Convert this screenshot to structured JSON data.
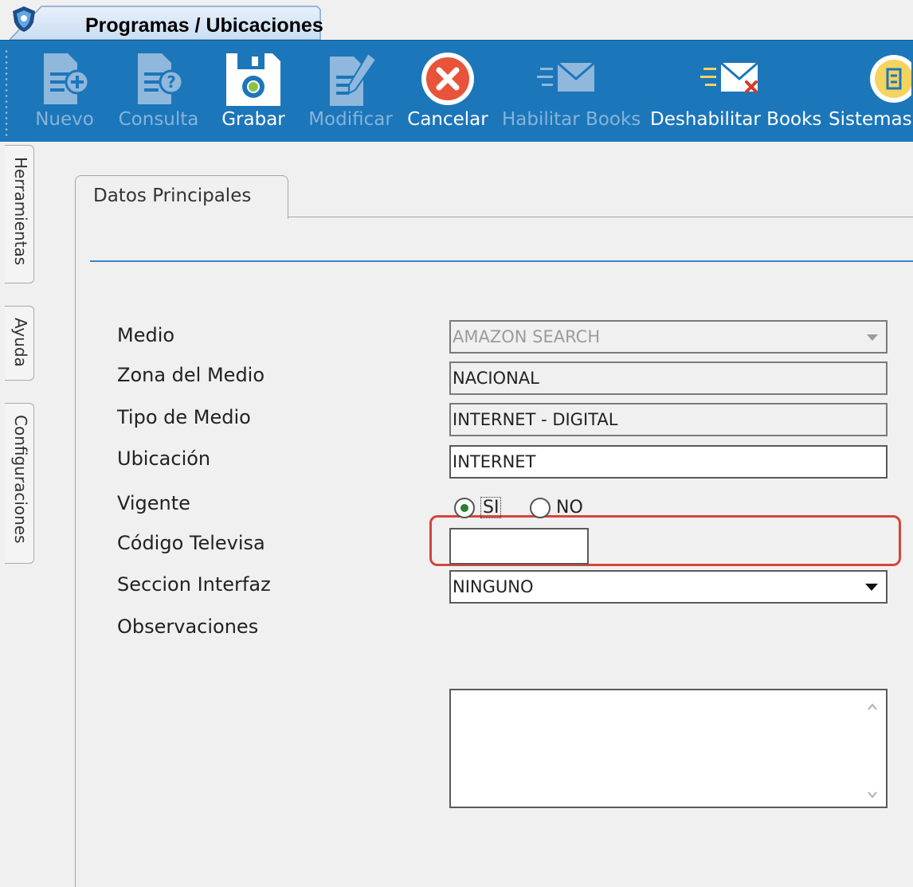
{
  "window": {
    "tab_title": "Programas / Ubicaciones",
    "icon": "shield-logo-icon"
  },
  "toolbar": {
    "buttons": [
      {
        "label": "Nuevo",
        "icon": "new-document-icon",
        "enabled": false
      },
      {
        "label": "Consulta",
        "icon": "query-document-icon",
        "enabled": false
      },
      {
        "label": "Grabar",
        "icon": "save-disk-icon",
        "enabled": true
      },
      {
        "label": "Modificar",
        "icon": "edit-document-icon",
        "enabled": false
      },
      {
        "label": "Cancelar",
        "icon": "cancel-icon",
        "enabled": true
      },
      {
        "label": "Habilitar Books",
        "icon": "mail-send-icon",
        "enabled": false
      },
      {
        "label": "Deshabilitar Books",
        "icon": "mail-disable-icon",
        "enabled": true
      },
      {
        "label": "Sistemas I",
        "icon": "systems-icon",
        "enabled": true
      }
    ]
  },
  "sidetabs": [
    "Herramientas",
    "Ayuda",
    "Configuraciones"
  ],
  "panel": {
    "tab_label": "Datos Principales",
    "fields": {
      "medio": {
        "label": "Medio",
        "value": "AMAZON SEARCH"
      },
      "zona": {
        "label": "Zona del Medio",
        "value": "NACIONAL"
      },
      "tipo": {
        "label": "Tipo de Medio",
        "value": "INTERNET - DIGITAL"
      },
      "ubicacion": {
        "label": "Ubicación",
        "value": "INTERNET"
      },
      "vigente": {
        "label": "Vigente",
        "options": [
          "SI",
          "NO"
        ],
        "selected": "SI"
      },
      "codigo": {
        "label": "Código Televisa",
        "value": ""
      },
      "seccion": {
        "label": "Seccion Interfaz",
        "value": "NINGUNO"
      },
      "observaciones": {
        "label": "Observaciones",
        "value": ""
      }
    }
  },
  "colors": {
    "toolbar_bg": "#1c76ba",
    "highlight": "#d4463b",
    "radio_selected": "#2e7d32"
  }
}
